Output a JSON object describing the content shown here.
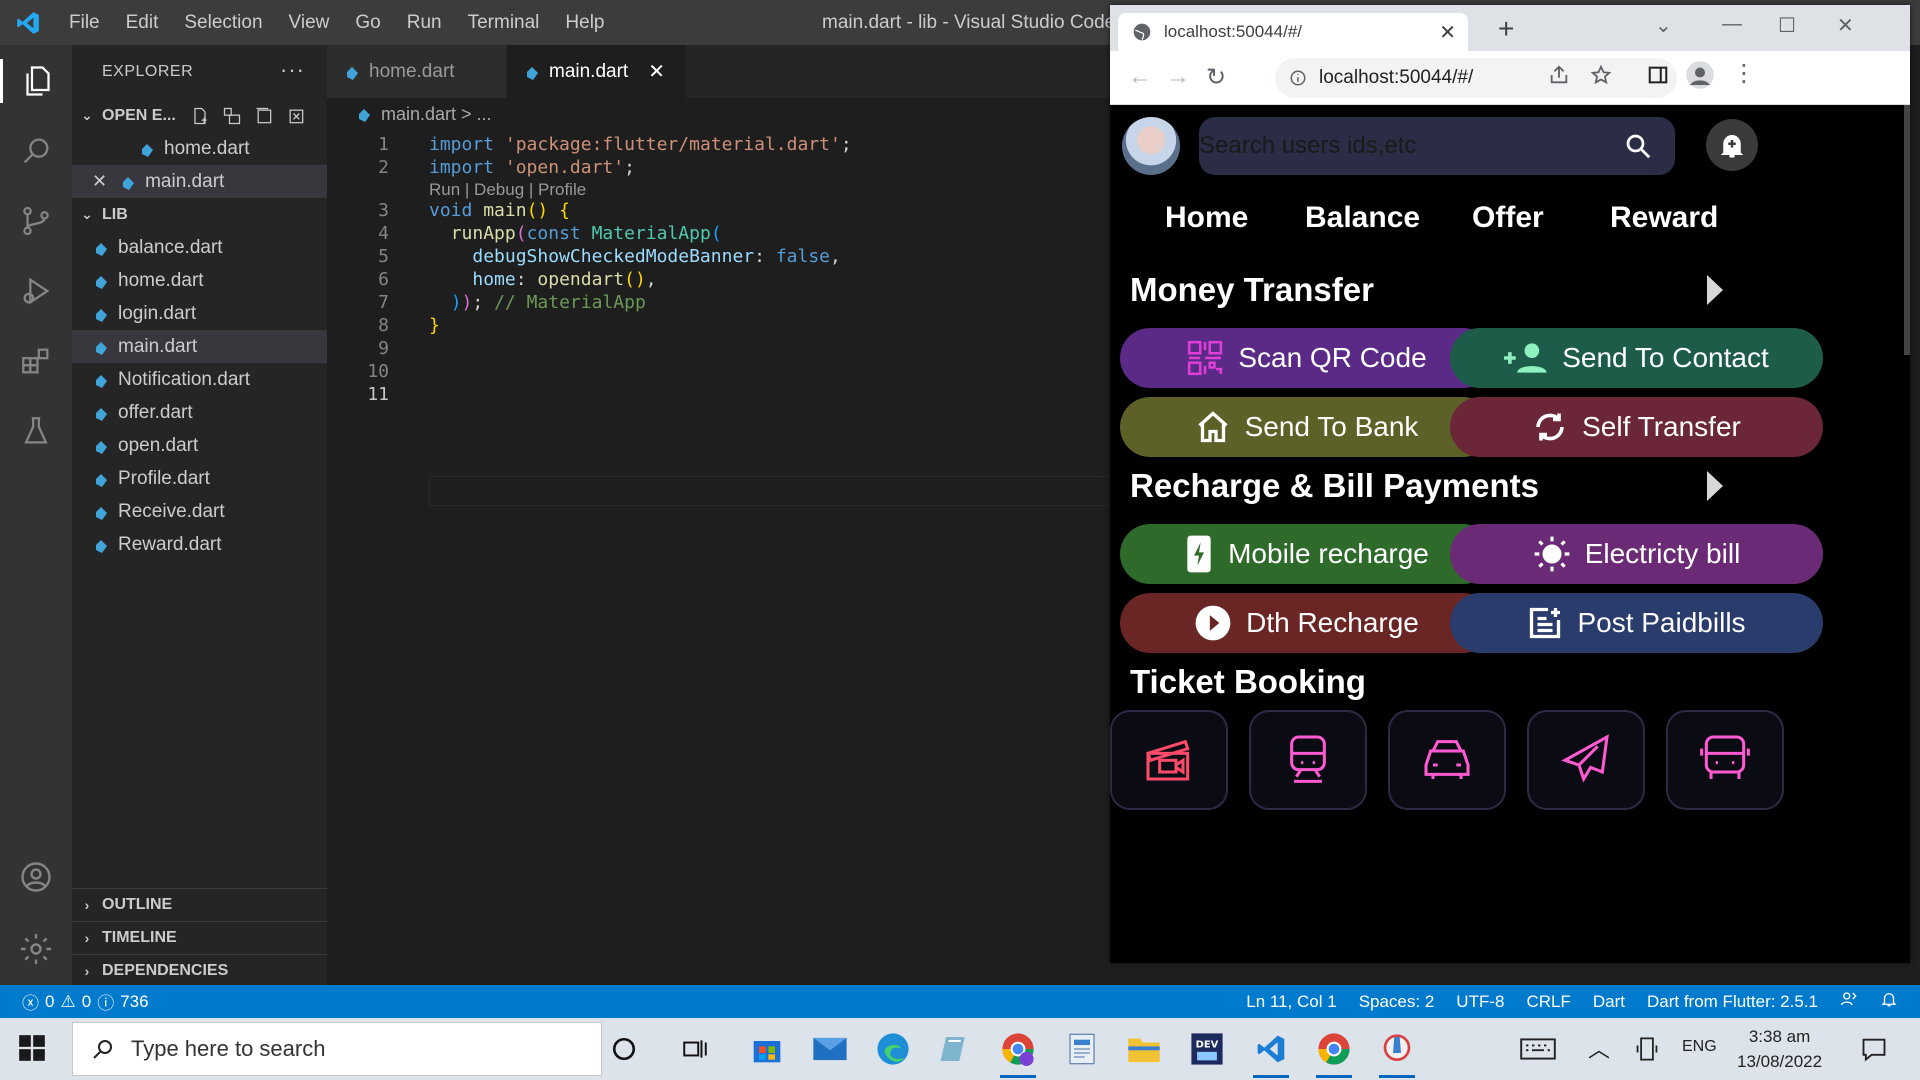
{
  "vscode": {
    "menu": [
      "File",
      "Edit",
      "Selection",
      "View",
      "Go",
      "Run",
      "Terminal",
      "Help"
    ],
    "window_title": "main.dart - lib - Visual Studio Code",
    "explorer": {
      "title": "EXPLORER",
      "open_editors_label": "OPEN E...",
      "open_editors": [
        "home.dart",
        "main.dart"
      ],
      "folder_label": "LIB",
      "files": [
        "balance.dart",
        "home.dart",
        "login.dart",
        "main.dart",
        "Notification.dart",
        "offer.dart",
        "open.dart",
        "Profile.dart",
        "Receive.dart",
        "Reward.dart"
      ],
      "outline_label": "OUTLINE",
      "timeline_label": "TIMELINE",
      "dependencies_label": "DEPENDENCIES"
    },
    "tabs": [
      "home.dart",
      "main.dart"
    ],
    "breadcrumb": "main.dart > ...",
    "code_lens": "Run | Debug | Profile",
    "code": {
      "l1_kw": "import",
      "l1_str": "'package:flutter/material.dart'",
      "l2_kw": "import",
      "l2_str": "'open.dart'",
      "l3_kw": "void",
      "l3_fn": "main",
      "l4_fn": "runApp",
      "l4_kw": "const",
      "l4_type": "MaterialApp",
      "l5_prop": "debugShowCheckedModeBanner",
      "l5_val": "false",
      "l6_prop": "home",
      "l6_fn": "opendart",
      "l7_comment": "// MaterialApp"
    },
    "line_numbers": [
      "1",
      "2",
      "3",
      "4",
      "5",
      "6",
      "7",
      "8",
      "9",
      "10",
      "11"
    ],
    "status": {
      "errors": "0",
      "warnings": "0",
      "info": "736",
      "position": "Ln 11, Col 1",
      "spaces": "Spaces: 2",
      "encoding": "UTF-8",
      "eol": "CRLF",
      "language": "Dart",
      "sdk": "Dart from Flutter: 2.5.1"
    }
  },
  "browser": {
    "tab_title": "localhost:50044/#/",
    "address": "localhost:50044/#/",
    "app": {
      "search_placeholder": "Search users ids,etc",
      "nav": [
        "Home",
        "Balance",
        "Offer",
        "Reward"
      ],
      "sections": {
        "money_transfer": "Money Transfer",
        "recharge": "Recharge & Bill Payments",
        "ticket": "Ticket Booking"
      },
      "money_buttons": [
        {
          "label": "Scan QR Code",
          "icon": "qr-code-icon",
          "color": "#5b2a86"
        },
        {
          "label": "Send To Contact",
          "icon": "add-person-icon",
          "color": "#1e5c4a"
        },
        {
          "label": "Send To Bank",
          "icon": "bank-home-icon",
          "color": "#5d6128"
        },
        {
          "label": "Self Transfer",
          "icon": "sync-icon",
          "color": "#6b2638"
        }
      ],
      "recharge_buttons": [
        {
          "label": "Mobile recharge",
          "icon": "mobile-charge-icon",
          "color": "#2e6b2b"
        },
        {
          "label": "Electricty bill",
          "icon": "sun-icon",
          "color": "#6b2a75"
        },
        {
          "label": "Dth Recharge",
          "icon": "play-icon",
          "color": "#6a2525"
        },
        {
          "label": "Post Paidbills",
          "icon": "post-add-icon",
          "color": "#2a3c6b"
        }
      ],
      "tickets": [
        "movie-clapper-icon",
        "train-icon",
        "car-icon",
        "airplane-icon",
        "bus-icon"
      ]
    }
  },
  "taskbar": {
    "search_placeholder": "Type here to search",
    "lang": "ENG",
    "time": "3:38 am",
    "date": "13/08/2022"
  }
}
